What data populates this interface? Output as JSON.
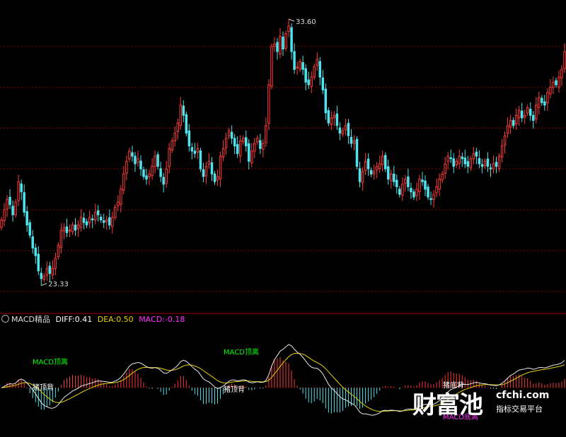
{
  "chart_data": [
    {
      "type": "candlestick",
      "ylim": [
        22.3,
        34.2
      ],
      "grid": true,
      "colors": {
        "up": "#ff3b3b",
        "down": "#4fe3ec",
        "grid": "#8b0000"
      },
      "annotations": {
        "high": "33.60",
        "low": "23.33"
      },
      "closes": [
        25.8,
        26.2,
        26.6,
        26.4,
        26.0,
        26.5,
        27.3,
        26.9,
        26.1,
        25.6,
        25.2,
        24.7,
        24.4,
        23.8,
        23.5,
        23.6,
        23.9,
        23.7,
        23.9,
        24.3,
        24.8,
        25.4,
        25.5,
        25.3,
        25.4,
        25.6,
        25.4,
        25.6,
        25.9,
        25.7,
        25.6,
        25.9,
        25.8,
        26.1,
        26.0,
        25.8,
        25.7,
        25.8,
        25.6,
        25.9,
        26.3,
        26.5,
        27.0,
        27.6,
        28.1,
        28.5,
        28.3,
        28.0,
        28.2,
        27.8,
        27.5,
        27.4,
        27.6,
        27.9,
        28.3,
        27.9,
        27.5,
        27.2,
        27.8,
        28.6,
        28.9,
        29.2,
        29.6,
        30.3,
        29.9,
        29.2,
        28.7,
        28.5,
        28.4,
        28.6,
        27.8,
        27.5,
        27.9,
        28.1,
        27.6,
        27.3,
        27.5,
        28.3,
        28.6,
        29.0,
        29.3,
        29.0,
        28.7,
        28.4,
        28.9,
        29.0,
        28.7,
        28.1,
        28.5,
        28.8,
        29.0,
        28.6,
        28.8,
        29.5,
        31.1,
        32.6,
        32.7,
        32.4,
        33.0,
        32.5,
        33.1,
        33.4,
        32.4,
        31.7,
        31.8,
        32.0,
        31.7,
        31.2,
        31.1,
        31.4,
        31.8,
        32.1,
        31.4,
        30.9,
        30.0,
        29.6,
        29.8,
        29.9,
        29.5,
        29.2,
        29.3,
        29.5,
        29.1,
        28.8,
        28.9,
        27.9,
        27.3,
        27.7,
        28.1,
        27.8,
        27.6,
        27.7,
        27.9,
        28.0,
        28.3,
        27.8,
        27.4,
        27.6,
        27.3,
        27.1,
        26.8,
        27.2,
        27.4,
        27.1,
        26.9,
        26.7,
        27.0,
        27.4,
        27.3,
        27.0,
        26.7,
        26.6,
        26.8,
        27.1,
        27.4,
        27.6,
        28.0,
        28.3,
        28.2,
        27.9,
        28.1,
        28.3,
        28.2,
        28.0,
        27.9,
        28.2,
        28.4,
        28.3,
        28.0,
        27.9,
        28.1,
        27.9,
        27.8,
        28.0,
        27.9,
        28.3,
        28.7,
        29.1,
        29.5,
        29.7,
        29.5,
        29.9,
        30.1,
        29.8,
        29.9,
        30.2,
        29.9,
        29.7,
        30.3,
        30.6,
        30.4,
        30.3,
        30.8,
        31.0,
        31.2,
        31.1,
        31.4,
        31.7,
        32.4
      ]
    },
    {
      "type": "macd",
      "title": "MACD精品",
      "DIFF": 0.41,
      "DEA": 0.5,
      "MACD": -0.18,
      "ylim": [
        -1.3,
        1.8
      ],
      "colors": {
        "diff": "#e8e8e8",
        "dea": "#e6d200",
        "pos": "#ff3b3b",
        "neg": "#4fe3ec",
        "label": "#00ff00",
        "macd_label": "#ff2fff"
      },
      "labels": [
        {
          "text": "MACD顶离",
          "color": "green"
        },
        {
          "text": "MACD顶离",
          "color": "green"
        },
        {
          "text": "猪顶背",
          "color": "white"
        },
        {
          "text": "猪顶背",
          "color": "white"
        },
        {
          "text": "猪底背",
          "color": "white"
        },
        {
          "text": "MACD底离",
          "color": "magenta"
        }
      ]
    }
  ],
  "info": {
    "title": "MACD精品",
    "diff_label": "DIFF:",
    "diff_value": "0.41",
    "dea_label": "DEA:",
    "dea_value": "0.50",
    "macd_label": "MACD:",
    "macd_value": "-0.18"
  },
  "watermark": {
    "cn": "财富池",
    "url": "cfchi.com",
    "sub": "指标交易平台"
  }
}
